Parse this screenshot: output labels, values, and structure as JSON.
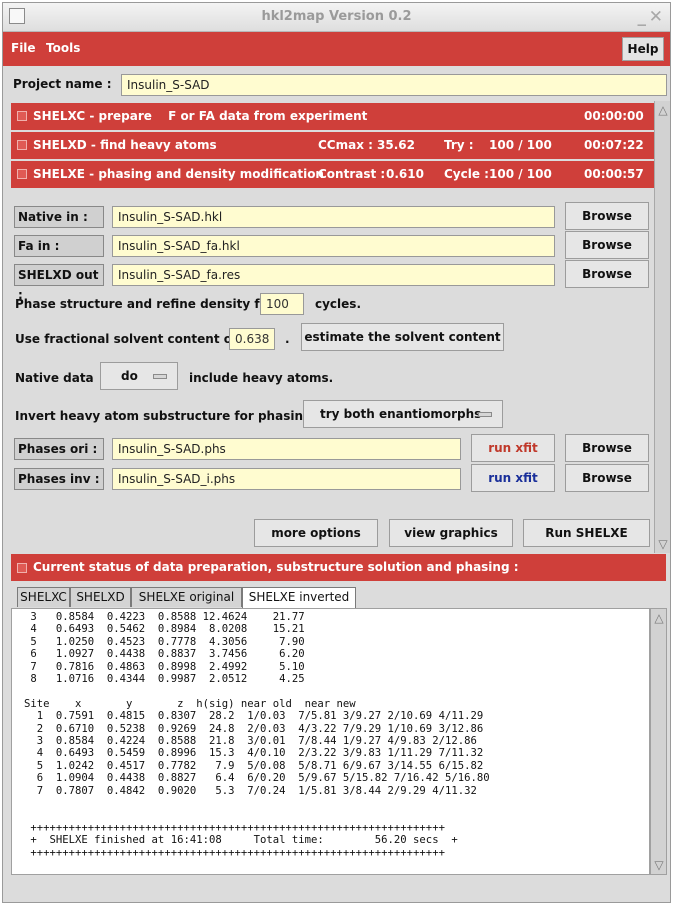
{
  "window": {
    "title": "hkl2map Version 0.2"
  },
  "menu": {
    "file": "File",
    "tools": "Tools",
    "help": "Help"
  },
  "project": {
    "label": "Project name :",
    "value": "Insulin_S-SAD"
  },
  "steps": [
    {
      "name": "SHELXC - prepare  F or FA data from experiment",
      "time": "00:00:00"
    },
    {
      "name": "SHELXD - find heavy atoms",
      "stat1_label": "CCmax :",
      "stat1_value": "35.62",
      "stat2_label": "Try :",
      "stat2_value": "100 / 100",
      "time": "00:07:22"
    },
    {
      "name": "SHELXE - phasing and density modification",
      "stat1_label": "Contrast :",
      "stat1_value": "0.610",
      "stat2_label": "Cycle :",
      "stat2_value": "100 / 100",
      "time": "00:00:57"
    }
  ],
  "files": {
    "native_label": "Native in :",
    "native_value": "Insulin_S-SAD.hkl",
    "fa_label": "Fa in :",
    "fa_value": "Insulin_S-SAD_fa.hkl",
    "shelxd_label": "SHELXD out :",
    "shelxd_value": "Insulin_S-SAD_fa.res",
    "browse": "Browse"
  },
  "options": {
    "cycles_prefix": "Phase structure and refine density for",
    "cycles_value": "100",
    "cycles_suffix": "cycles.",
    "solvent_prefix": "Use fractional solvent content of",
    "solvent_value": "0.638",
    "solvent_dot": ".",
    "estimate_button": "estimate the solvent content",
    "native_prefix": "Native data",
    "native_option": "do",
    "native_suffix": "include heavy atoms.",
    "invert_prefix": "Invert heavy atom substructure for phasing?",
    "invert_option": "try both enantiomorphs"
  },
  "phases": {
    "ori_label": "Phases ori :",
    "ori_value": "Insulin_S-SAD.phs",
    "inv_label": "Phases inv :",
    "inv_value": "Insulin_S-SAD_i.phs",
    "runxfit": "run xfit",
    "runxfit_color_ori": "#c0392b",
    "runxfit_color_inv": "#1a2f9a"
  },
  "actions": {
    "more_options": "more options",
    "view_graphics": "view graphics",
    "run_shelxe": "Run SHELXE"
  },
  "status_title": "Current status of data preparation, substructure solution and phasing :",
  "tabs": [
    "SHELXC",
    "SHELXD",
    "SHELXE original",
    "SHELXE inverted"
  ],
  "active_tab": "SHELXE inverted",
  "log_lines": [
    " 3   0.8584  0.4223  0.8588 12.4624    21.77",
    " 4   0.6493  0.5462  0.8984  8.0208    15.21",
    " 5   1.0250  0.4523  0.7778  4.3056     7.90",
    " 6   1.0927  0.4438  0.8837  3.7456     6.20",
    " 7   0.7816  0.4863  0.8998  2.4992     5.10",
    " 8   1.0716  0.4344  0.9987  2.0512     4.25",
    "",
    "Site    x       y       z  h(sig) near old  near new",
    "  1  0.7591  0.4815  0.8307  28.2  1/0.03  7/5.81 3/9.27 2/10.69 4/11.29",
    "  2  0.6710  0.5238  0.9269  24.8  2/0.03  4/3.22 7/9.29 1/10.69 3/12.86",
    "  3  0.8584  0.4224  0.8588  21.8  3/0.01  7/8.44 1/9.27 4/9.83 2/12.86",
    "  4  0.6493  0.5459  0.8996  15.3  4/0.10  2/3.22 3/9.83 1/11.29 7/11.32",
    "  5  1.0242  0.4517  0.7782   7.9  5/0.08  5/8.71 6/9.67 3/14.55 6/15.82",
    "  6  1.0904  0.4438  0.8827   6.4  6/0.20  5/9.67 5/15.82 7/16.42 5/16.80",
    "  7  0.7807  0.4842  0.9020   5.3  7/0.24  1/5.81 3/8.44 2/9.29 4/11.32",
    "",
    "",
    " +++++++++++++++++++++++++++++++++++++++++++++++++++++++++++++++++",
    " +  SHELXE finished at 16:41:08     Total time:        56.20 secs  +",
    " +++++++++++++++++++++++++++++++++++++++++++++++++++++++++++++++++"
  ]
}
